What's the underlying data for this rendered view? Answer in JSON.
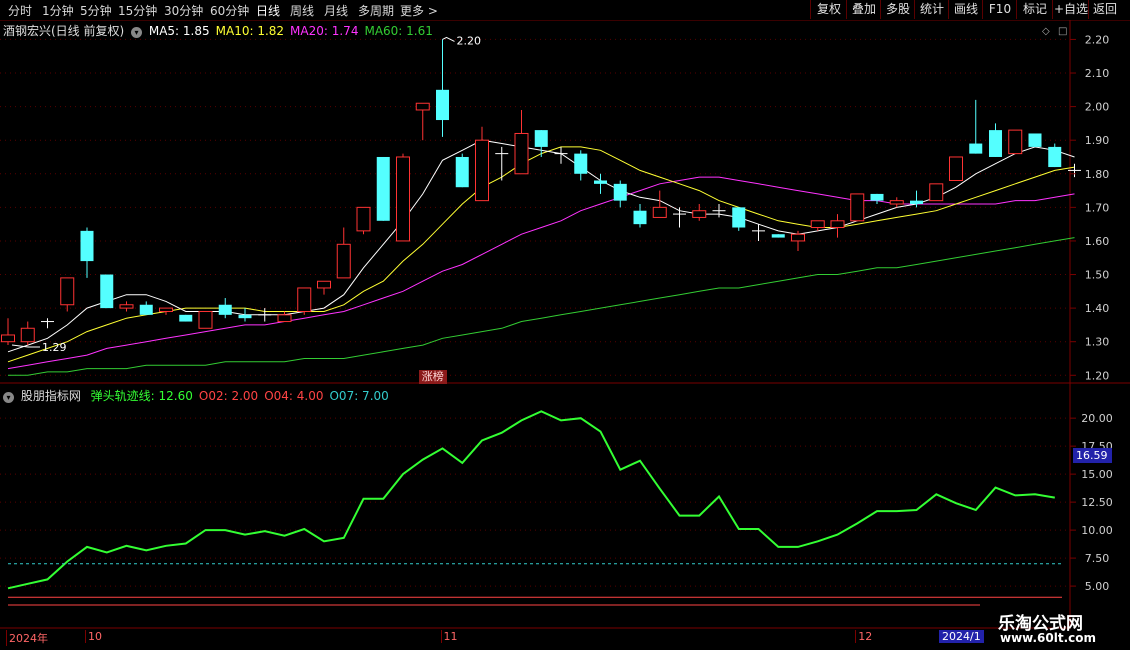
{
  "toolbar": {
    "left_tabs": [
      "分时",
      "1分钟",
      "5分钟",
      "15分钟",
      "30分钟",
      "60分钟",
      "日线",
      "周线",
      "月线",
      "多周期",
      "更多 >"
    ],
    "active_tab": "日线",
    "right_buttons": [
      "复权",
      "叠加",
      "多股",
      "统计",
      "画线",
      "F10",
      "标记",
      "+自选",
      "返回"
    ]
  },
  "price_panel": {
    "title": "酒钢宏兴(日线 前复权)",
    "ma": [
      {
        "label": "MA5: 1.85",
        "color": "#ffffff"
      },
      {
        "label": "MA10: 1.82",
        "color": "#ffff33"
      },
      {
        "label": "MA20: 1.74",
        "color": "#ff33ff"
      },
      {
        "label": "MA60: 1.61",
        "color": "#33cc33"
      }
    ],
    "high_label": "2.20",
    "low_label": "1.29",
    "badge": "涨榜"
  },
  "indicator_panel": {
    "title": "股朋指标网",
    "items": [
      {
        "label": "弹头轨迹线: 12.60",
        "color": "#33ff33"
      },
      {
        "label": "O02: 2.00",
        "color": "#ff4444"
      },
      {
        "label": "O04: 4.00",
        "color": "#ff4444"
      },
      {
        "label": "O07: 7.00",
        "color": "#33cccc"
      }
    ],
    "current_value": "16.59"
  },
  "time_axis": {
    "labels": [
      {
        "text": "2024年",
        "idx": 0
      },
      {
        "text": "10",
        "idx": 4
      },
      {
        "text": "11",
        "idx": 22
      },
      {
        "text": "12",
        "idx": 43
      }
    ],
    "cursor_label": "2024/1"
  },
  "watermark": {
    "line1": "乐淘公式网",
    "line2": "www.60lt.com"
  },
  "chart_data": [
    {
      "type": "candlestick",
      "price_ticks": [
        1.2,
        1.3,
        1.4,
        1.5,
        1.6,
        1.7,
        1.8,
        1.9,
        2.0,
        2.1,
        2.2
      ],
      "ylim": [
        1.18,
        2.24
      ],
      "candles": [
        {
          "o": 1.3,
          "h": 1.37,
          "l": 1.29,
          "c": 1.32
        },
        {
          "o": 1.3,
          "h": 1.36,
          "l": 1.29,
          "c": 1.34
        },
        {
          "o": 1.36,
          "h": 1.37,
          "l": 1.34,
          "c": 1.36
        },
        {
          "o": 1.41,
          "h": 1.49,
          "l": 1.39,
          "c": 1.49
        },
        {
          "o": 1.63,
          "h": 1.64,
          "l": 1.49,
          "c": 1.54
        },
        {
          "o": 1.5,
          "h": 1.5,
          "l": 1.4,
          "c": 1.4
        },
        {
          "o": 1.4,
          "h": 1.42,
          "l": 1.39,
          "c": 1.41
        },
        {
          "o": 1.41,
          "h": 1.42,
          "l": 1.38,
          "c": 1.38
        },
        {
          "o": 1.39,
          "h": 1.4,
          "l": 1.38,
          "c": 1.4
        },
        {
          "o": 1.38,
          "h": 1.38,
          "l": 1.36,
          "c": 1.36
        },
        {
          "o": 1.34,
          "h": 1.39,
          "l": 1.34,
          "c": 1.39
        },
        {
          "o": 1.41,
          "h": 1.43,
          "l": 1.37,
          "c": 1.38
        },
        {
          "o": 1.38,
          "h": 1.4,
          "l": 1.36,
          "c": 1.37
        },
        {
          "o": 1.38,
          "h": 1.4,
          "l": 1.36,
          "c": 1.38
        },
        {
          "o": 1.36,
          "h": 1.39,
          "l": 1.36,
          "c": 1.38
        },
        {
          "o": 1.39,
          "h": 1.46,
          "l": 1.38,
          "c": 1.46
        },
        {
          "o": 1.46,
          "h": 1.48,
          "l": 1.44,
          "c": 1.48
        },
        {
          "o": 1.49,
          "h": 1.64,
          "l": 1.49,
          "c": 1.59
        },
        {
          "o": 1.63,
          "h": 1.7,
          "l": 1.62,
          "c": 1.7
        },
        {
          "o": 1.85,
          "h": 1.85,
          "l": 1.66,
          "c": 1.66
        },
        {
          "o": 1.6,
          "h": 1.86,
          "l": 1.6,
          "c": 1.85
        },
        {
          "o": 1.99,
          "h": 2.01,
          "l": 1.9,
          "c": 2.01
        },
        {
          "o": 2.05,
          "h": 2.2,
          "l": 1.91,
          "c": 1.96
        },
        {
          "o": 1.85,
          "h": 1.86,
          "l": 1.76,
          "c": 1.76
        },
        {
          "o": 1.72,
          "h": 1.94,
          "l": 1.72,
          "c": 1.9
        },
        {
          "o": 1.86,
          "h": 1.88,
          "l": 1.78,
          "c": 1.86
        },
        {
          "o": 1.8,
          "h": 1.99,
          "l": 1.8,
          "c": 1.92
        },
        {
          "o": 1.93,
          "h": 1.93,
          "l": 1.85,
          "c": 1.88
        },
        {
          "o": 1.86,
          "h": 1.88,
          "l": 1.83,
          "c": 1.86
        },
        {
          "o": 1.86,
          "h": 1.87,
          "l": 1.78,
          "c": 1.8
        },
        {
          "o": 1.78,
          "h": 1.8,
          "l": 1.74,
          "c": 1.77
        },
        {
          "o": 1.77,
          "h": 1.78,
          "l": 1.7,
          "c": 1.72
        },
        {
          "o": 1.69,
          "h": 1.71,
          "l": 1.64,
          "c": 1.65
        },
        {
          "o": 1.67,
          "h": 1.75,
          "l": 1.67,
          "c": 1.7
        },
        {
          "o": 1.68,
          "h": 1.7,
          "l": 1.64,
          "c": 1.68
        },
        {
          "o": 1.67,
          "h": 1.71,
          "l": 1.66,
          "c": 1.69
        },
        {
          "o": 1.69,
          "h": 1.71,
          "l": 1.67,
          "c": 1.69
        },
        {
          "o": 1.7,
          "h": 1.7,
          "l": 1.63,
          "c": 1.64
        },
        {
          "o": 1.63,
          "h": 1.65,
          "l": 1.6,
          "c": 1.63
        },
        {
          "o": 1.62,
          "h": 1.62,
          "l": 1.61,
          "c": 1.61
        },
        {
          "o": 1.6,
          "h": 1.63,
          "l": 1.57,
          "c": 1.62
        },
        {
          "o": 1.64,
          "h": 1.66,
          "l": 1.63,
          "c": 1.66
        },
        {
          "o": 1.64,
          "h": 1.68,
          "l": 1.61,
          "c": 1.66
        },
        {
          "o": 1.66,
          "h": 1.74,
          "l": 1.66,
          "c": 1.74
        },
        {
          "o": 1.74,
          "h": 1.74,
          "l": 1.71,
          "c": 1.72
        },
        {
          "o": 1.71,
          "h": 1.73,
          "l": 1.7,
          "c": 1.72
        },
        {
          "o": 1.72,
          "h": 1.75,
          "l": 1.7,
          "c": 1.71
        },
        {
          "o": 1.72,
          "h": 1.77,
          "l": 1.72,
          "c": 1.77
        },
        {
          "o": 1.78,
          "h": 1.85,
          "l": 1.78,
          "c": 1.85
        },
        {
          "o": 1.89,
          "h": 2.02,
          "l": 1.86,
          "c": 1.86
        },
        {
          "o": 1.93,
          "h": 1.95,
          "l": 1.85,
          "c": 1.85
        },
        {
          "o": 1.86,
          "h": 1.93,
          "l": 1.86,
          "c": 1.93
        },
        {
          "o": 1.92,
          "h": 1.92,
          "l": 1.88,
          "c": 1.88
        },
        {
          "o": 1.88,
          "h": 1.89,
          "l": 1.82,
          "c": 1.82
        },
        {
          "o": 1.81,
          "h": 1.83,
          "l": 1.79,
          "c": 1.81
        }
      ],
      "ma5": [
        1.27,
        1.29,
        1.31,
        1.35,
        1.4,
        1.42,
        1.44,
        1.44,
        1.42,
        1.39,
        1.39,
        1.39,
        1.38,
        1.38,
        1.38,
        1.39,
        1.4,
        1.44,
        1.52,
        1.59,
        1.66,
        1.74,
        1.84,
        1.87,
        1.9,
        1.89,
        1.88,
        1.87,
        1.86,
        1.82,
        1.78,
        1.75,
        1.73,
        1.72,
        1.69,
        1.68,
        1.68,
        1.67,
        1.65,
        1.63,
        1.62,
        1.63,
        1.64,
        1.66,
        1.68,
        1.7,
        1.71,
        1.73,
        1.76,
        1.8,
        1.83,
        1.86,
        1.88,
        1.87,
        1.85
      ],
      "ma10": [
        1.24,
        1.26,
        1.28,
        1.3,
        1.33,
        1.35,
        1.37,
        1.38,
        1.39,
        1.4,
        1.4,
        1.4,
        1.4,
        1.39,
        1.39,
        1.39,
        1.39,
        1.41,
        1.45,
        1.48,
        1.54,
        1.59,
        1.65,
        1.71,
        1.76,
        1.79,
        1.83,
        1.86,
        1.88,
        1.88,
        1.87,
        1.84,
        1.81,
        1.79,
        1.77,
        1.75,
        1.72,
        1.7,
        1.68,
        1.66,
        1.65,
        1.64,
        1.64,
        1.65,
        1.66,
        1.67,
        1.68,
        1.69,
        1.71,
        1.73,
        1.75,
        1.77,
        1.79,
        1.81,
        1.82
      ],
      "ma20": [
        1.22,
        1.23,
        1.24,
        1.25,
        1.26,
        1.28,
        1.29,
        1.3,
        1.31,
        1.32,
        1.33,
        1.34,
        1.35,
        1.35,
        1.36,
        1.37,
        1.38,
        1.39,
        1.41,
        1.43,
        1.45,
        1.48,
        1.51,
        1.53,
        1.56,
        1.59,
        1.62,
        1.64,
        1.66,
        1.69,
        1.71,
        1.73,
        1.75,
        1.77,
        1.78,
        1.79,
        1.79,
        1.78,
        1.77,
        1.76,
        1.75,
        1.74,
        1.73,
        1.72,
        1.72,
        1.71,
        1.71,
        1.71,
        1.71,
        1.71,
        1.71,
        1.72,
        1.72,
        1.73,
        1.74
      ],
      "ma60": [
        1.2,
        1.2,
        1.21,
        1.21,
        1.22,
        1.22,
        1.22,
        1.23,
        1.23,
        1.23,
        1.23,
        1.24,
        1.24,
        1.24,
        1.24,
        1.25,
        1.25,
        1.25,
        1.26,
        1.27,
        1.28,
        1.29,
        1.31,
        1.32,
        1.33,
        1.34,
        1.36,
        1.37,
        1.38,
        1.39,
        1.4,
        1.41,
        1.42,
        1.43,
        1.44,
        1.45,
        1.46,
        1.46,
        1.47,
        1.48,
        1.49,
        1.5,
        1.5,
        1.51,
        1.52,
        1.52,
        1.53,
        1.54,
        1.55,
        1.56,
        1.57,
        1.58,
        1.59,
        1.6,
        1.61
      ]
    },
    {
      "type": "line",
      "ticks": [
        5.0,
        7.5,
        10.0,
        12.5,
        15.0,
        17.5,
        20.0
      ],
      "ylim": [
        3.4,
        21.8
      ],
      "series": [
        {
          "name": "弹头轨迹线",
          "color": "#33ff33",
          "values": [
            4.8,
            5.2,
            5.6,
            7.2,
            8.5,
            8.0,
            8.6,
            8.2,
            8.6,
            8.8,
            10.0,
            10.0,
            9.6,
            9.9,
            9.5,
            10.1,
            9.0,
            9.3,
            12.8,
            12.8,
            15.0,
            16.3,
            17.3,
            16.0,
            18.0,
            18.7,
            19.8,
            20.6,
            19.8,
            20.0,
            18.8,
            15.4,
            16.2,
            13.7,
            11.3,
            11.3,
            13.0,
            10.1,
            10.1,
            8.5,
            8.5,
            9.0,
            9.6,
            10.6,
            11.7,
            11.7,
            11.8,
            13.2,
            12.4,
            11.8,
            13.8,
            13.1,
            13.2,
            12.9
          ]
        },
        {
          "name": "O02",
          "color": "#ff4444",
          "constant": 2.0
        },
        {
          "name": "O04",
          "color": "#ff4444",
          "constant": 4.0
        },
        {
          "name": "O07",
          "color": "#33cccc",
          "constant": 7.0
        }
      ]
    }
  ]
}
